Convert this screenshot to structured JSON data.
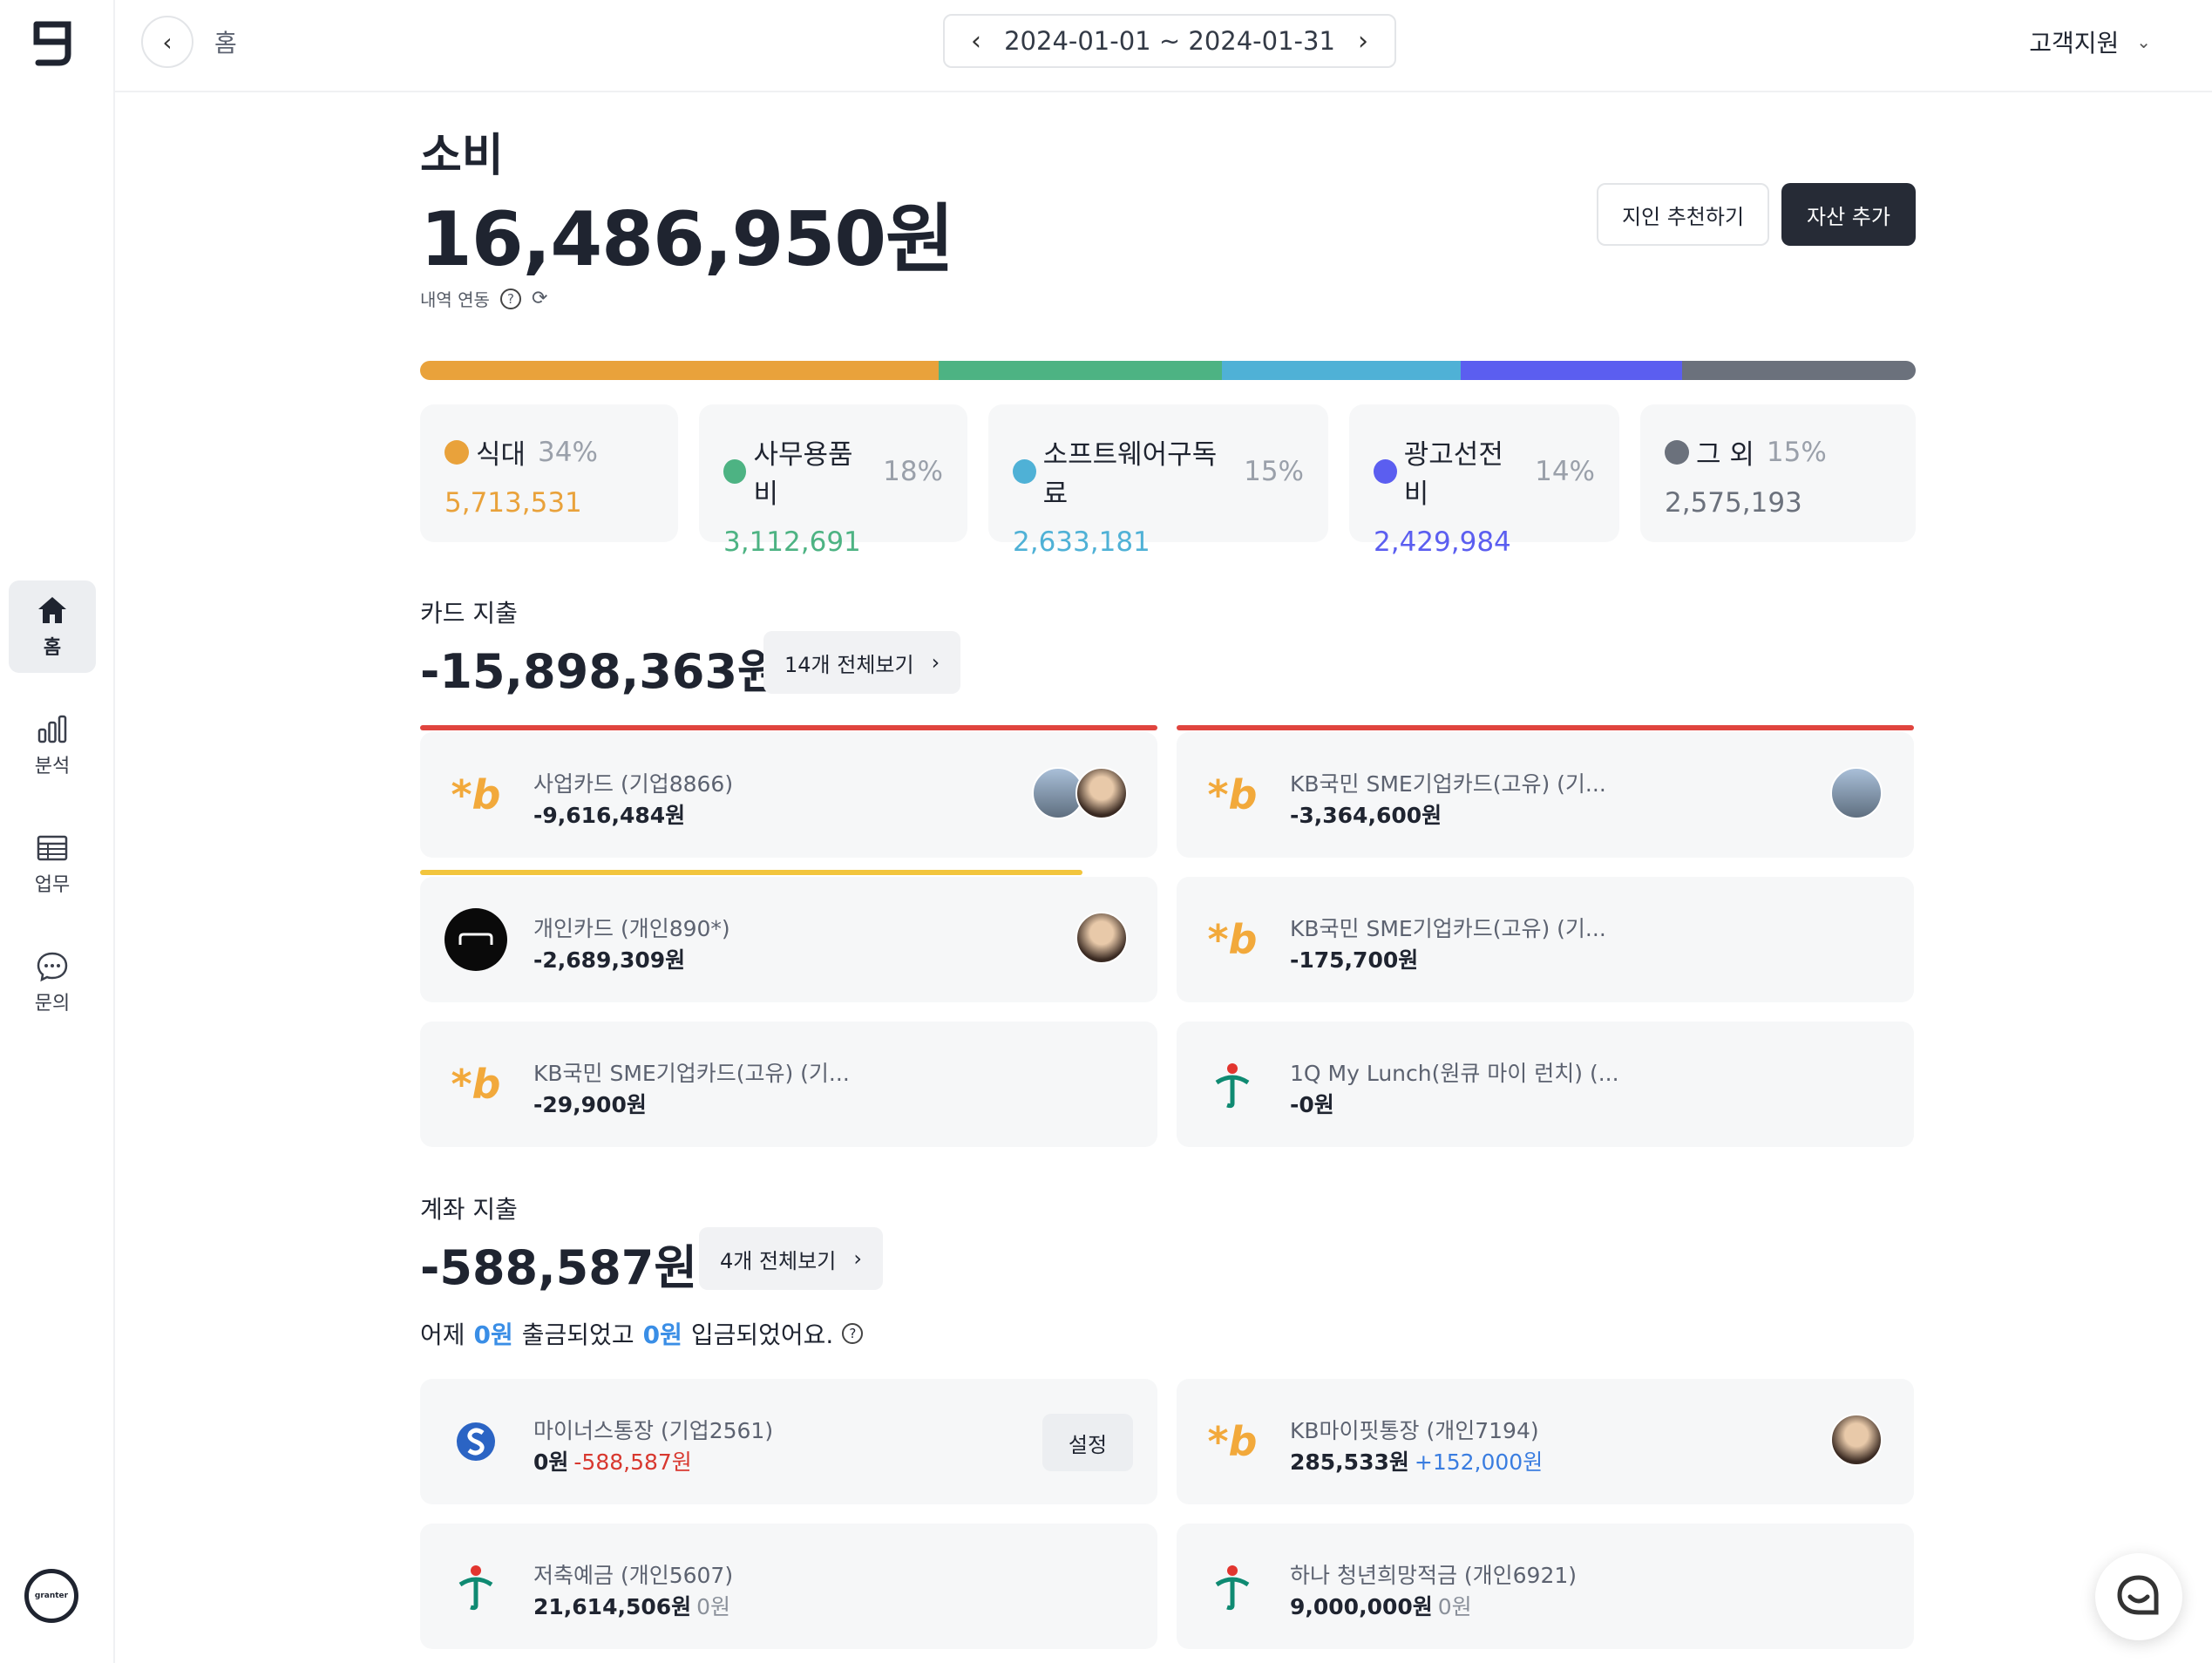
{
  "sidebar": {
    "logo": "g",
    "items": [
      {
        "label": "홈",
        "icon": "home-icon",
        "active": true
      },
      {
        "label": "분석",
        "icon": "bar-chart-icon",
        "active": false
      },
      {
        "label": "업무",
        "icon": "table-icon",
        "active": false
      },
      {
        "label": "문의",
        "icon": "chat-bubble-icon",
        "active": false
      }
    ],
    "bottom_logo": "granter"
  },
  "topbar": {
    "breadcrumb": "홈",
    "date_range": "2024-01-01 ~ 2024-01-31",
    "support_label": "고객지원"
  },
  "summary": {
    "title": "소비",
    "total": "16,486,950원",
    "sync_label": "내역 연동",
    "recommend_button": "지인 추천하기",
    "add_asset_button": "자산 추가"
  },
  "categories": [
    {
      "name": "식대",
      "pct": "34%",
      "amount": "5,713,531",
      "color": "#e9a23b",
      "share": 34.65
    },
    {
      "name": "사무용품비",
      "pct": "18%",
      "amount": "3,112,691",
      "color": "#4db383",
      "share": 18.88
    },
    {
      "name": "소프트웨어구독료",
      "pct": "15%",
      "amount": "2,633,181",
      "color": "#4fb1d6",
      "share": 15.97
    },
    {
      "name": "광고선전비",
      "pct": "14%",
      "amount": "2,429,984",
      "color": "#5b5ef0",
      "share": 14.74
    },
    {
      "name": "그 외",
      "pct": "15%",
      "amount": "2,575,193",
      "color": "#6b717c",
      "share": 15.62
    }
  ],
  "card_spending": {
    "label": "카드 지출",
    "total": "-15,898,363원",
    "view_all": "14개 전체보기",
    "cards": [
      {
        "name": "사업카드 (기업8866)",
        "amount": "-9,616,484원",
        "bank": "KB",
        "limit_color": "#e0443e",
        "limit_fill": 1.0
      },
      {
        "name": "KB국민 SME기업카드(고유) (기...",
        "amount": "-3,364,600원",
        "bank": "KB",
        "limit_color": "#e0443e",
        "limit_fill": 1.0
      },
      {
        "name": "개인카드 (개인890*)",
        "amount": "-2,689,309원",
        "bank": "hyundai",
        "limit_color": "#f2c53d",
        "limit_fill": 0.9
      },
      {
        "name": "KB국민 SME기업카드(고유) (기...",
        "amount": "-175,700원",
        "bank": "KB"
      },
      {
        "name": "KB국민 SME기업카드(고유) (기...",
        "amount": "-29,900원",
        "bank": "KB"
      },
      {
        "name": "1Q My Lunch(원큐 마이 런치) (...",
        "amount": "-0원",
        "bank": "hana"
      }
    ]
  },
  "account_spending": {
    "label": "계좌 지출",
    "total": "-588,587원",
    "view_all": "4개 전체보기",
    "info_prefix": "어제",
    "info_out": "0원",
    "info_mid": "출금되었고",
    "info_in": "0원",
    "info_suffix": "입금되었어요.",
    "accounts": [
      {
        "name": "마이너스통장 (기업2561)",
        "balance": "0원",
        "change": "-588,587원",
        "change_color": "#d8382f",
        "bank": "shinhan",
        "setting": "설정"
      },
      {
        "name": "KB마이핏통장 (개인7194)",
        "balance": "285,533원",
        "change": "+152,000원",
        "change_color": "#3a7de0",
        "bank": "KB"
      },
      {
        "name": "저축예금 (개인5607)",
        "balance": "21,614,506원",
        "change": "0원",
        "change_color": "#8a909a",
        "bank": "hana"
      },
      {
        "name": "하나 청년희망적금 (개인6921)",
        "balance": "9,000,000원",
        "change": "0원",
        "change_color": "#8a909a",
        "bank": "hana"
      }
    ]
  }
}
